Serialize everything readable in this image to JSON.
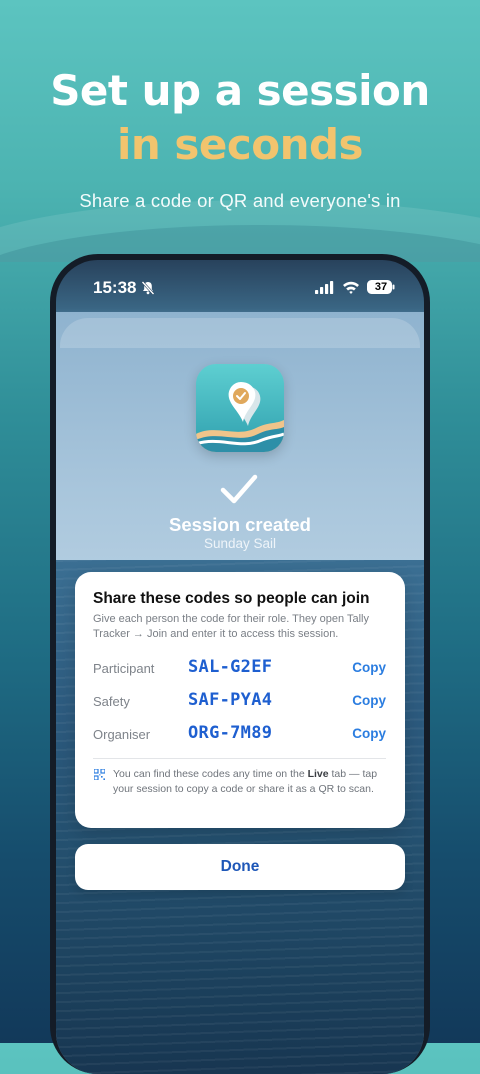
{
  "hero": {
    "headline_line1": "Set up a session",
    "headline_line2": "in seconds",
    "subtitle": "Share a code or QR and everyone's in",
    "headline_highlight_color": "#f2c46e"
  },
  "status_bar": {
    "time": "15:38",
    "battery": "37"
  },
  "session": {
    "title": "Session created",
    "name": "Sunday Sail"
  },
  "codes_card": {
    "title": "Share these codes so people can join",
    "description": "Give each person the code for their role. They open Tally Tracker → Join and enter it to access this session.",
    "rows": [
      {
        "label": "Participant",
        "code": "SAL-G2EF",
        "action": "Copy"
      },
      {
        "label": "Safety",
        "code": "SAF-PYA4",
        "action": "Copy"
      },
      {
        "label": "Organiser",
        "code": "ORG-7M89",
        "action": "Copy"
      }
    ],
    "note_prefix": "You can find these codes any time on the ",
    "note_bold": "Live",
    "note_suffix": " tab — tap your session to copy a code or share it as a QR to scan."
  },
  "done_button": {
    "label": "Done"
  },
  "colors": {
    "code_blue": "#1e5fd0",
    "copy_blue": "#2b7de0",
    "done_blue": "#1e57b8"
  }
}
